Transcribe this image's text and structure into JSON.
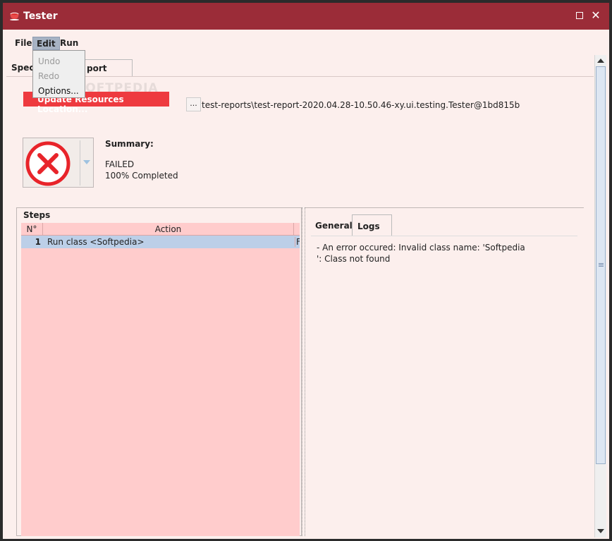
{
  "window": {
    "title": "Tester",
    "maximize_glyph": "",
    "close_glyph": "✕"
  },
  "menubar": {
    "file": "File",
    "edit": "Edit",
    "run": "Run"
  },
  "edit_menu": {
    "items": [
      {
        "label": "Undo",
        "enabled": false
      },
      {
        "label": "Redo",
        "enabled": false
      },
      {
        "label": "Options...",
        "enabled": true
      }
    ]
  },
  "tabs": {
    "specification": "Speci",
    "report": "port"
  },
  "report": {
    "update_button": "Update Resources Location...",
    "browse_button": "...",
    "path": "test-reports\\test-report-2020.04.28-10.50.46-xy.ui.testing.Tester@1bd815b",
    "watermark": "SOFTPEDIA"
  },
  "summary": {
    "label": "Summary:",
    "status": "FAILED",
    "progress": "100% Completed"
  },
  "steps": {
    "title": "Steps",
    "columns": [
      "N°",
      "Action"
    ],
    "rows": [
      {
        "no": "1",
        "action": "Run class <Softpedia>",
        "extra": "F"
      }
    ]
  },
  "details": {
    "tabs": [
      "General",
      "Logs"
    ],
    "log_lines": [
      "- An error occured: Invalid class name: 'Softpedia",
      "': Class not found"
    ]
  },
  "colors": {
    "titlebar": "#9b2c38",
    "background": "#fcefed",
    "update_button": "#ee3a3f",
    "steps_table": "#ffcccc",
    "selected_row": "#bccfe8",
    "failed_icon": "#e8242a"
  }
}
